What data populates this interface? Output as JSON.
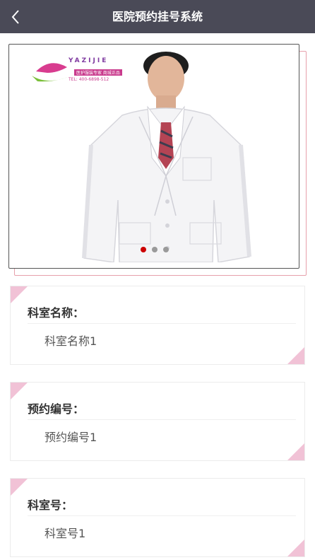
{
  "header": {
    "title": "医院预约挂号系统",
    "back_icon": "chevron-left-icon",
    "bg_color": "#4a4a57"
  },
  "banner": {
    "logo_text": "YAZIJIE",
    "logo_sub": "医护服装专家 商城正品",
    "logo_tel": "TEL: 400-6898-512",
    "slide_count": 3,
    "active_slide": 1
  },
  "cards": [
    {
      "label": "科室名称：",
      "value": "科室名称1"
    },
    {
      "label": "预约编号：",
      "value": "预约编号1"
    },
    {
      "label": "科室号：",
      "value": "科室号1"
    }
  ],
  "colors": {
    "accent_pink": "#f1c2d6",
    "active_dot": "#cc0000"
  }
}
